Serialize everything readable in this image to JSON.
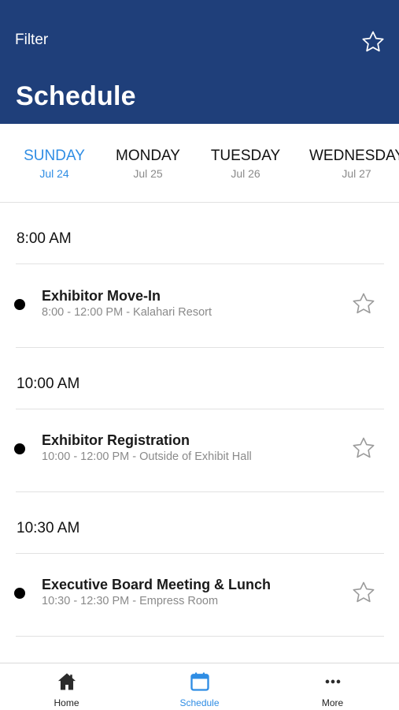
{
  "header": {
    "filter_label": "Filter",
    "title": "Schedule",
    "bg_color": "#1f3f7a",
    "star_icon": "star-outline-icon"
  },
  "days": [
    {
      "name": "SUNDAY",
      "date": "Jul 24",
      "active": true
    },
    {
      "name": "MONDAY",
      "date": "Jul 25",
      "active": false
    },
    {
      "name": "TUESDAY",
      "date": "Jul 26",
      "active": false
    },
    {
      "name": "WEDNESDAY",
      "date": "Jul 27",
      "active": false
    }
  ],
  "accent_color": "#2f8de4",
  "schedule": [
    {
      "time": "8:00 AM",
      "sessions": [
        {
          "title": "Exhibitor Move-In",
          "subtitle": "8:00 - 12:00 PM - Kalahari Resort"
        }
      ]
    },
    {
      "time": "10:00 AM",
      "sessions": [
        {
          "title": "Exhibitor Registration",
          "subtitle": "10:00 - 12:00 PM - Outside of Exhibit Hall"
        }
      ]
    },
    {
      "time": "10:30 AM",
      "sessions": [
        {
          "title": "Executive Board Meeting & Lunch",
          "subtitle": "10:30 - 12:30 PM - Empress Room"
        }
      ]
    }
  ],
  "tabs": [
    {
      "label": "Home",
      "icon": "home-icon",
      "active": false
    },
    {
      "label": "Schedule",
      "icon": "calendar-icon",
      "active": true
    },
    {
      "label": "More",
      "icon": "more-dots-icon",
      "active": false
    }
  ]
}
